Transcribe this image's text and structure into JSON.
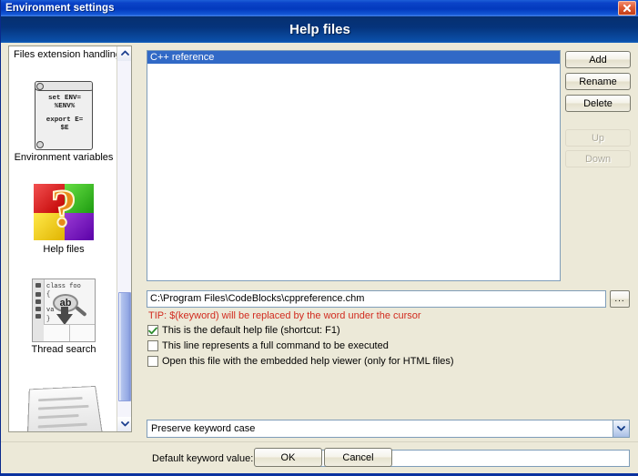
{
  "window": {
    "title": "Environment settings",
    "close_icon": "close-icon"
  },
  "header": {
    "title": "Help files"
  },
  "sidebar": {
    "title": "Files extension handling",
    "scroll_up_icon": "chevron-up-icon",
    "scroll_down_icon": "chevron-down-icon",
    "items": [
      {
        "label": "Environment variables",
        "icon": "scroll-document-icon",
        "icon_text_line1": "set ENV=",
        "icon_text_line2": "%ENV%",
        "icon_text_line3": "export E=",
        "icon_text_line4": "$E"
      },
      {
        "label": "Help files",
        "icon": "question-mark-cube-icon",
        "glyph": "?"
      },
      {
        "label": "Thread search",
        "icon": "magnifier-code-icon",
        "code_line1": "class foo",
        "code_line2": "{",
        "code_line3": "va",
        "code_line4": "}",
        "mag_text": "ab"
      },
      {
        "label": "",
        "icon": "document-page-icon"
      }
    ]
  },
  "main": {
    "list": {
      "items": [
        {
          "label": "C++ reference",
          "selected": true
        }
      ]
    },
    "buttons": [
      {
        "label": "Add",
        "name": "add-button",
        "disabled": false
      },
      {
        "label": "Rename",
        "name": "rename-button",
        "disabled": false
      },
      {
        "label": "Delete",
        "name": "delete-button",
        "disabled": false
      },
      {
        "label": "Up",
        "name": "up-button",
        "disabled": true
      },
      {
        "label": "Down",
        "name": "down-button",
        "disabled": true
      }
    ],
    "path_field": {
      "value": "C:\\Program Files\\CodeBlocks\\cppreference.chm",
      "placeholder": ""
    },
    "browse_button_label": "...",
    "tip": "TIP: $(keyword) will be replaced by the word under the cursor",
    "checkboxes": [
      {
        "label": "This is the default help file (shortcut: F1)",
        "checked": true
      },
      {
        "label": "This line represents a full command to be executed",
        "checked": false
      },
      {
        "label": "Open this file with the embedded help viewer (only for HTML files)",
        "checked": false
      }
    ],
    "keyword_case_combo": {
      "value": "Preserve keyword case",
      "arrow_icon": "chevron-down-icon"
    },
    "default_keyword": {
      "label": "Default keyword value:",
      "value": "",
      "placeholder": ""
    }
  },
  "footer": {
    "ok_label": "OK",
    "cancel_label": "Cancel"
  },
  "colors": {
    "titlebar_blue": "#0b43c8",
    "header_navy": "#05337b",
    "dialog_bg": "#ece9d8",
    "selection_blue": "#3169c6",
    "tip_red": "#d12b1f"
  }
}
